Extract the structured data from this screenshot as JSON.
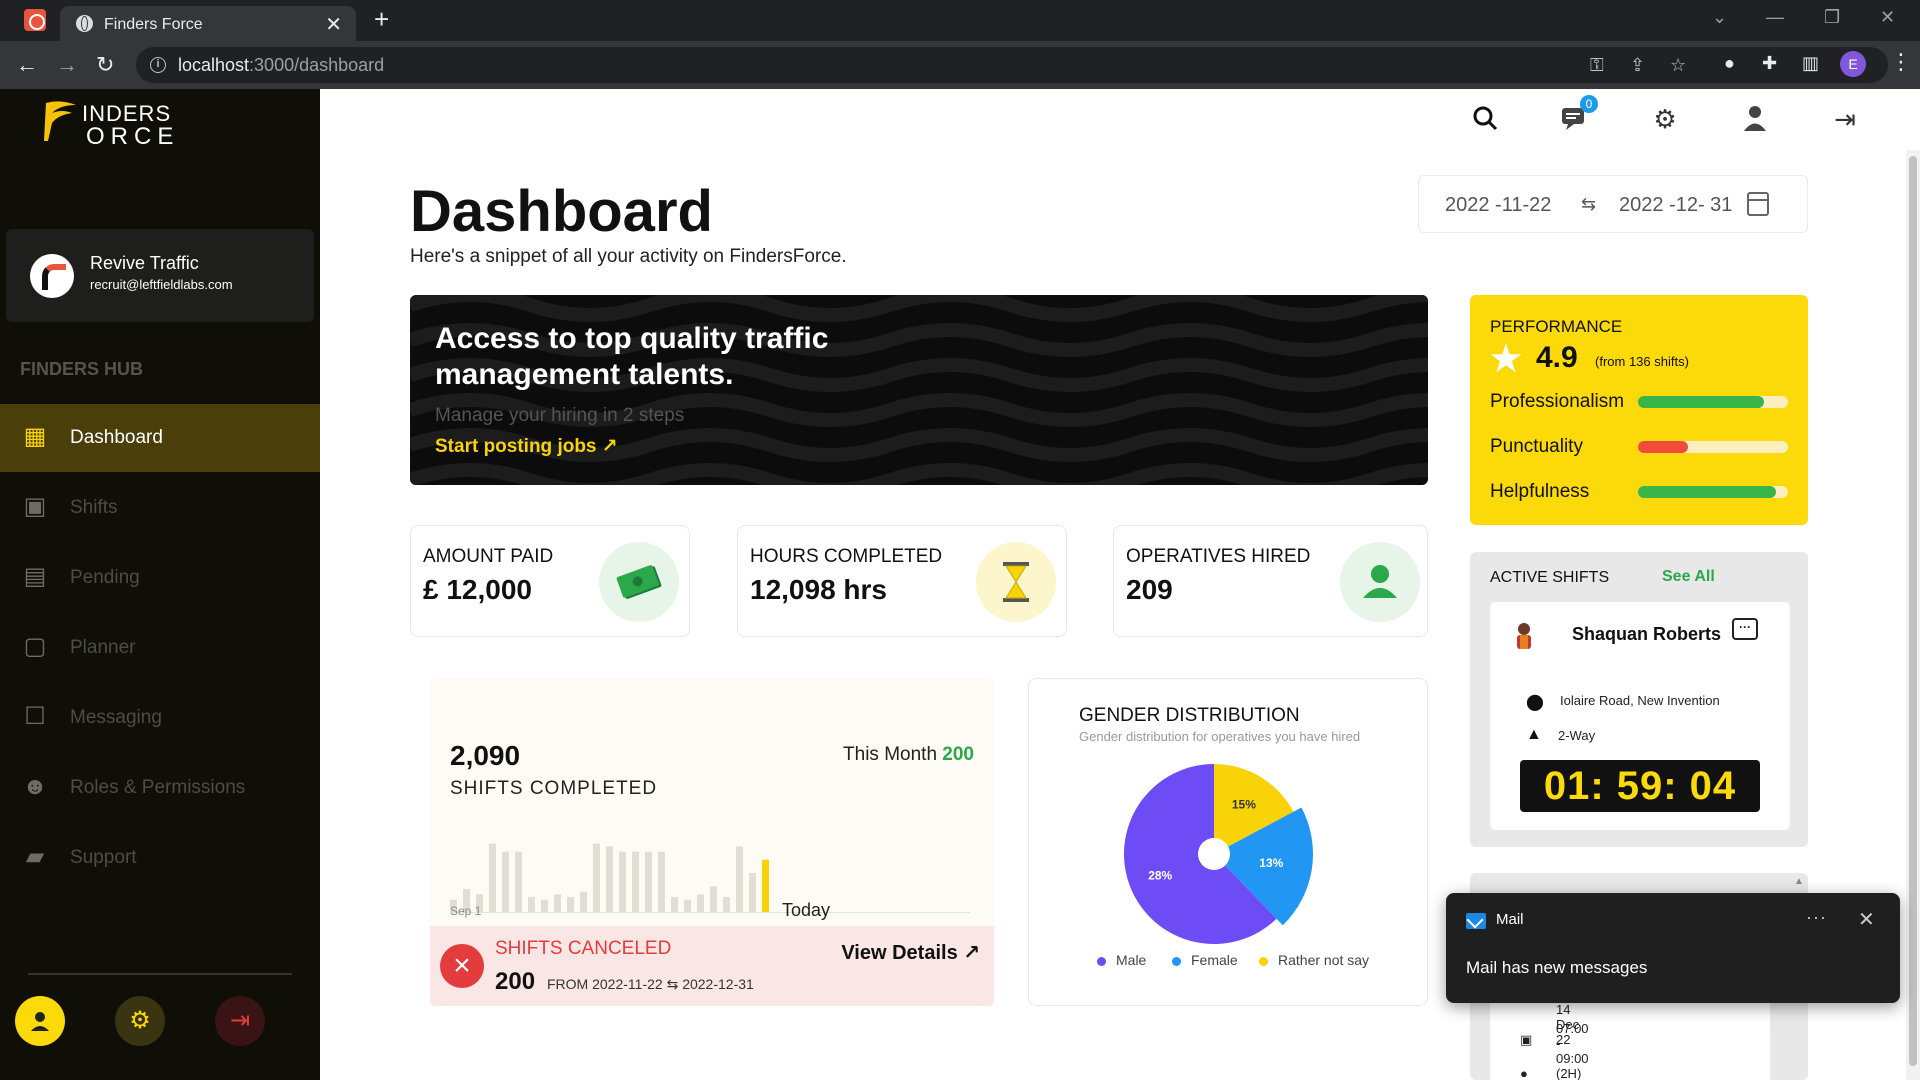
{
  "browser": {
    "tab_title": "Finders Force",
    "tab_close": "✕",
    "new_tab": "+",
    "url_host": "localhost",
    "url_path": ":3000/dashboard"
  },
  "sidebar": {
    "logo_line1": "INDERS",
    "logo_line2": "ORCE",
    "user_name": "Revive Traffic",
    "user_email": "recruit@leftfieldlabs.com",
    "hub_label": "FINDERS HUB",
    "items": [
      {
        "label": "Dashboard",
        "icon": "dashboard-icon",
        "active": true
      },
      {
        "label": "Shifts",
        "icon": "briefcase-icon",
        "active": false
      },
      {
        "label": "Pending",
        "icon": "document-icon",
        "active": false
      },
      {
        "label": "Planner",
        "icon": "calendar-icon",
        "active": false
      },
      {
        "label": "Messaging",
        "icon": "chat-icon",
        "active": false
      },
      {
        "label": "Roles & Permissions",
        "icon": "users-icon",
        "active": false
      },
      {
        "label": "Support",
        "icon": "support-icon",
        "active": false
      }
    ]
  },
  "header": {
    "notif_count": "0",
    "title": "Dashboard",
    "subtitle": "Here's a snippet of all your activity on FindersForce.",
    "date_from": "2022 -11-22",
    "date_sep": "⇆",
    "date_to": "2022 -12- 31"
  },
  "hero": {
    "title": "Access to top quality traffic management talents.",
    "subtitle": "Manage your hiring in 2 steps",
    "cta": "Start posting jobs ↗"
  },
  "stats": [
    {
      "label": "AMOUNT PAID",
      "value": "£ 12,000",
      "icon": "money-icon"
    },
    {
      "label": "HOURS COMPLETED",
      "value": "12,098 hrs",
      "icon": "hourglass-icon"
    },
    {
      "label": "OPERATIVES HIRED",
      "value": "209",
      "icon": "person-icon"
    }
  ],
  "shifts": {
    "count": "2,090",
    "label": "SHIFTS COMPLETED",
    "this_month_label": "This Month",
    "this_month_value": "200",
    "axis_start": "Sep 1",
    "axis_end": "Today",
    "canceled_title": "SHIFTS CANCELED",
    "canceled_value": "200",
    "canceled_from": "FROM 2022-11-22  ⇆  2022-12-31",
    "view_details": "View Details ↗"
  },
  "chart_data": {
    "type": "pie",
    "title": "GENDER DISTRIBUTION",
    "subtitle": "Gender distribution for operatives you have hired",
    "slices": [
      {
        "label": "Male",
        "pct": 28,
        "color": "#6e4cf5"
      },
      {
        "label": "Female",
        "pct": 13,
        "color": "#2196f3"
      },
      {
        "label": "Rather not say",
        "pct": 15,
        "color": "#f7d308"
      }
    ],
    "shifts_bar_values": [
      10,
      18,
      14,
      52,
      46,
      46,
      12,
      10,
      14,
      12,
      16,
      52,
      50,
      46,
      46,
      46,
      46,
      12,
      10,
      14,
      20,
      12,
      50,
      30,
      40
    ],
    "shifts_highlight_index": 24
  },
  "performance": {
    "title": "PERFORMANCE",
    "score": "4.9",
    "from": "(from 136 shifts)",
    "metrics": [
      {
        "label": "Professionalism",
        "value": 0.84,
        "color": "#3ab54a"
      },
      {
        "label": "Punctuality",
        "value": 0.33,
        "color": "#f04b3c"
      },
      {
        "label": "Helpfulness",
        "value": 0.92,
        "color": "#3ab54a"
      }
    ]
  },
  "active_shifts": {
    "title": "ACTIVE SHIFTS",
    "see_all": "See All",
    "worker": "Shaquan Roberts",
    "location": "Iolaire Road, New Invention",
    "road_type": "2-Way",
    "timer": "01: 59: 04"
  },
  "upcoming": {
    "date": "Wed, 14 Dec 22",
    "time": "07:00 - 09:00 (2H)"
  },
  "toast": {
    "app": "Mail",
    "message": "Mail has new messages",
    "more": "···",
    "close": "✕"
  }
}
